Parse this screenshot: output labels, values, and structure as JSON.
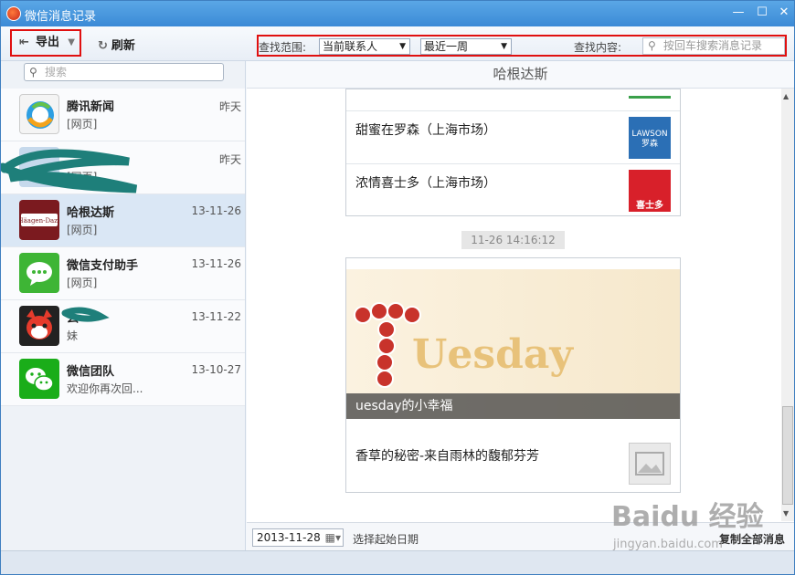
{
  "window": {
    "title": "微信消息记录",
    "min": "—",
    "max": "☐",
    "close": "✕"
  },
  "toolbar": {
    "export_label": "导出",
    "refresh_label": "刷新"
  },
  "filter": {
    "range_label": "查找范围:",
    "range_value": "当前联系人",
    "period_value": "最近一周",
    "content_label": "查找内容:",
    "content_placeholder": "按回车搜索消息记录"
  },
  "sidebar": {
    "search_placeholder": "搜索",
    "contacts": [
      {
        "name": "腾讯新闻",
        "preview": "[网页]",
        "date": "昨天"
      },
      {
        "name": "",
        "preview": "[网页]",
        "date": "昨天"
      },
      {
        "name": "哈根达斯",
        "preview": "[网页]",
        "date": "13-11-26"
      },
      {
        "name": "微信支付助手",
        "preview": "[网页]",
        "date": "13-11-26"
      },
      {
        "name": "么",
        "preview": "妹",
        "date": "13-11-22"
      },
      {
        "name": "微信团队",
        "preview": "欢迎你再次回...",
        "date": "13-10-27"
      }
    ]
  },
  "chat": {
    "title": "哈根达斯",
    "card1": {
      "items": [
        {
          "text": "甜蜜在罗森（上海市场）",
          "thumb": "LAWSON 罗森"
        },
        {
          "text": "浓情喜士多（上海市场）",
          "thumb": "喜士多"
        }
      ]
    },
    "timestamp": "11-26 14:16:12",
    "card2": {
      "banner_word": "Uesday",
      "banner_caption": "uesday的小幸福",
      "items": [
        {
          "text": "香草的秘密-来自雨林的馥郁芬芳"
        }
      ]
    }
  },
  "footer": {
    "date_value": "2013-11-28",
    "date_hint": "选择起始日期",
    "copy_all_label": "复制全部消息"
  },
  "watermark": {
    "brand": "Baidu 经验",
    "url": "jingyan.baidu.com"
  }
}
